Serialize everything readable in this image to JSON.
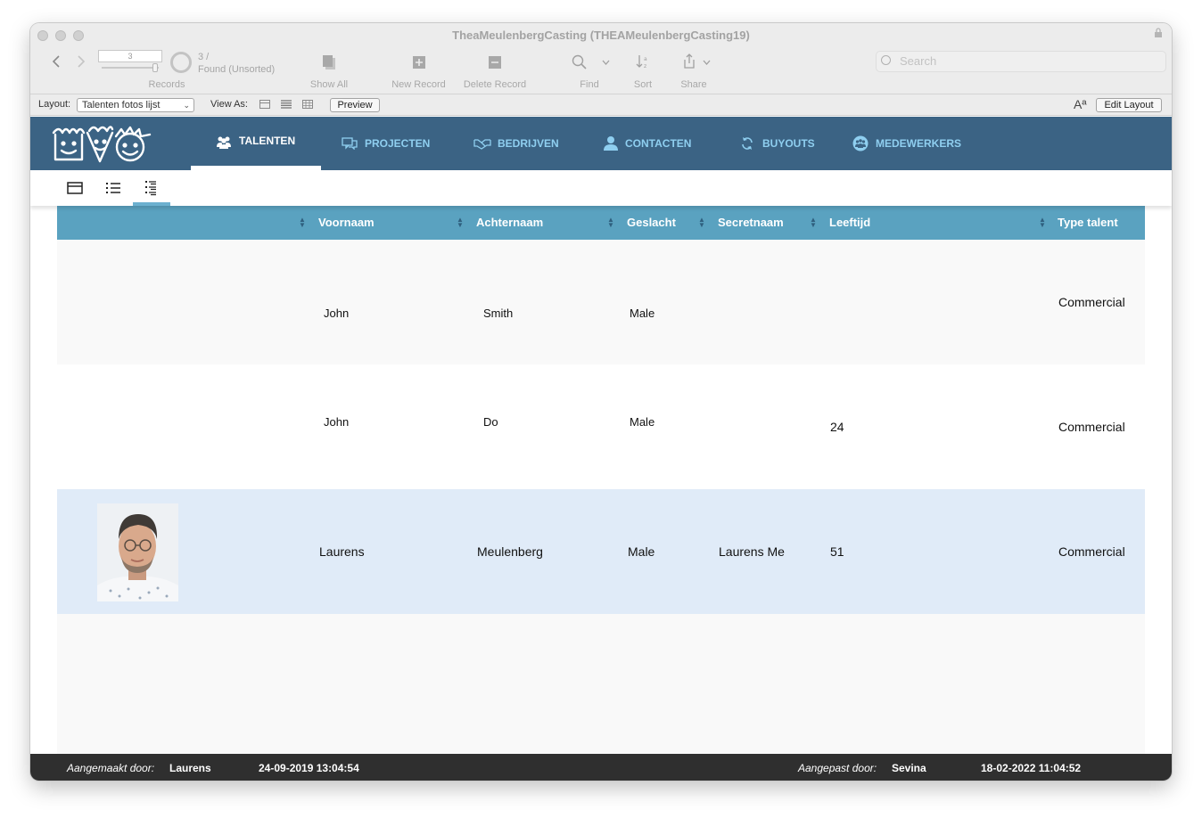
{
  "window": {
    "title": "TheaMeulenbergCasting (THEAMeulenbergCasting19)"
  },
  "toolbar": {
    "record_number": "3",
    "record_count": "3 /",
    "found_status": "Found (Unsorted)",
    "records_label": "Records",
    "show_all_label": "Show All",
    "new_record_label": "New Record",
    "delete_record_label": "Delete Record",
    "find_label": "Find",
    "sort_label": "Sort",
    "share_label": "Share",
    "search_placeholder": "Search"
  },
  "layoutbar": {
    "layout_label": "Layout:",
    "layout_value": "Talenten fotos lijst",
    "view_as_label": "View As:",
    "preview_label": "Preview",
    "edit_layout_label": "Edit Layout",
    "font_icon_text": "Aª"
  },
  "nav": {
    "items": [
      {
        "label": "TALENTEN",
        "icon": "people-icon",
        "active": true
      },
      {
        "label": "PROJECTEN",
        "icon": "chat-icon"
      },
      {
        "label": "BEDRIJVEN",
        "icon": "handshake-icon"
      },
      {
        "label": "CONTACTEN",
        "icon": "contact-icon"
      },
      {
        "label": "BUYOUTS",
        "icon": "refresh-icon"
      },
      {
        "label": "MEDEWERKERS",
        "icon": "group-icon"
      }
    ]
  },
  "table": {
    "columns": [
      "Voornaam",
      "Achternaam",
      "Geslacht",
      "Secretnaam",
      "Leeftijd",
      "Type talent"
    ],
    "rows": [
      {
        "voornaam": "John",
        "achternaam": "Smith",
        "geslacht": "Male",
        "secretnaam": "",
        "leeftijd": "",
        "type_talent": "Commercial"
      },
      {
        "voornaam": "John",
        "achternaam": "Do",
        "geslacht": "Male",
        "secretnaam": "",
        "leeftijd": "24",
        "type_talent": "Commercial"
      },
      {
        "voornaam": "Laurens",
        "achternaam": "Meulenberg",
        "geslacht": "Male",
        "secretnaam": "Laurens Me",
        "leeftijd": "51",
        "type_talent": "Commercial"
      }
    ]
  },
  "footer": {
    "created_label": "Aangemaakt door:",
    "created_by": "Laurens",
    "created_at": "24-09-2019 13:04:54",
    "modified_label": "Aangepast door:",
    "modified_by": "Sevina",
    "modified_at": "18-02-2022 11:04:52"
  },
  "colors": {
    "nav_bg": "#3b6384",
    "nav_text": "#8fcff0",
    "header_bg": "#5aa2c0",
    "selected_row": "#e0ebf8",
    "footer_bg": "#2f2f2f"
  }
}
